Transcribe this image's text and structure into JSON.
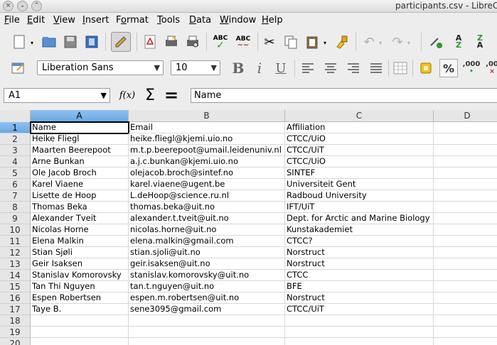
{
  "window": {
    "title": "participants.csv - LibreC"
  },
  "menu": [
    {
      "label": "File",
      "u": "F"
    },
    {
      "label": "Edit",
      "u": "E"
    },
    {
      "label": "View",
      "u": "V"
    },
    {
      "label": "Insert",
      "u": "I"
    },
    {
      "label": "Format",
      "u": "o"
    },
    {
      "label": "Tools",
      "u": "T"
    },
    {
      "label": "Data",
      "u": "D"
    },
    {
      "label": "Window",
      "u": "W"
    },
    {
      "label": "Help",
      "u": "H"
    }
  ],
  "toolbar": {
    "font_name": "Liberation Sans",
    "font_size": "10",
    "abc_label": "ABC",
    "number_format_1": ",000",
    "number_format_2": ",00"
  },
  "formula": {
    "cell_ref": "A1",
    "content": "Name"
  },
  "columns": [
    "A",
    "B",
    "C",
    "D"
  ],
  "rows": [
    [
      "Name",
      "Email",
      "Affiliation"
    ],
    [
      "Heike Fliegl",
      "heike.fliegl@kjemi.uio.no",
      "CTCC/UiO"
    ],
    [
      "Maarten Beerepoot",
      "m.t.p.beerepoot@umail.leidenuniv.nl",
      "CTCC/UiT"
    ],
    [
      "Arne Bunkan",
      "a.j.c.bunkan@kjemi.uio.no",
      "CTCC/UiO"
    ],
    [
      "Ole Jacob Broch",
      "olejacob.broch@sintef.no",
      "SINTEF"
    ],
    [
      "Karel Viaene",
      "karel.viaene@ugent.be",
      "Universiteit Gent"
    ],
    [
      "Lisette de Hoop",
      "L.deHoop@science.ru.nl",
      "Radboud University"
    ],
    [
      "Thomas Beka",
      "thomas.beka@uit.no",
      "IFT/UiT"
    ],
    [
      "Alexander Tveit",
      "alexander.t.tveit@uit.no",
      "Dept. for Arctic and Marine Biology"
    ],
    [
      "Nicolas Horne",
      "nicolas.horne@uit.no",
      "Kunstakademiet"
    ],
    [
      "Elena Malkin",
      "elena.malkin@gmail.com",
      "CTCC?"
    ],
    [
      "Stian Sjøli",
      "stian.sjoli@uit.no",
      "Norstruct"
    ],
    [
      "Geir Isaksen",
      "geir.isaksen@uit.no",
      "Norstruct"
    ],
    [
      "Stanislav Komorovsky",
      "stanislav.komorovsky@uit.no",
      "CTCC"
    ],
    [
      "Tan Thi Nguyen",
      "tan.t.nguyen@uit.no",
      "BFE"
    ],
    [
      "Espen Robertsen",
      "espen.m.robertsen@uit.no",
      "Norstruct"
    ],
    [
      "Taye B.",
      "sene3095@gmail.com",
      "CTCC/UiT"
    ],
    [
      "",
      "",
      ""
    ],
    [
      "",
      "",
      ""
    ],
    [
      "",
      "",
      ""
    ]
  ],
  "row_numbers": [
    "1",
    "2",
    "3",
    "4",
    "5",
    "6",
    "7",
    "8",
    "9",
    "10",
    "11",
    "12",
    "13",
    "14",
    "15",
    "16",
    "17",
    "18",
    "19",
    "20"
  ]
}
